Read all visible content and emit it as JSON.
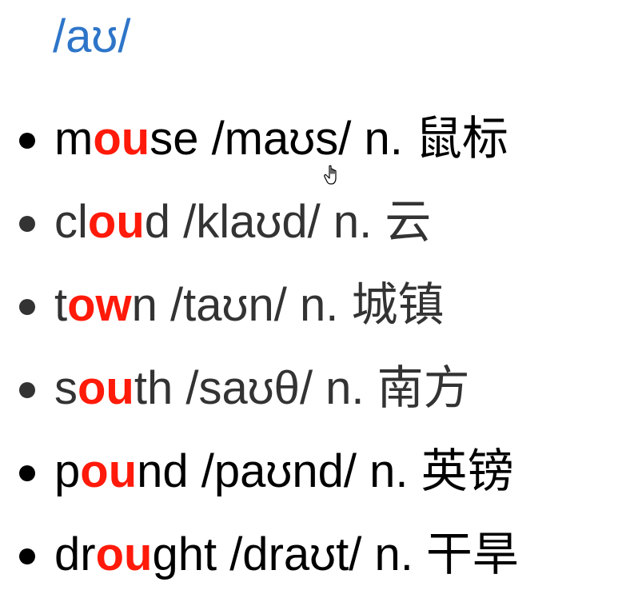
{
  "heading": "/aʊ/",
  "words": [
    {
      "pre": "m",
      "hl": "ou",
      "post": "se",
      "rest": " /maʊs/ n. 鼠标"
    },
    {
      "pre": "cl",
      "hl": "ou",
      "post": "d",
      "rest": " /klaʊd/ n. 云"
    },
    {
      "pre": "t",
      "hl": "ow",
      "post": "n",
      "rest": " /taʊn/ n. 城镇"
    },
    {
      "pre": "s",
      "hl": "ou",
      "post": "th",
      "rest": " /saʊθ/ n. 南方"
    },
    {
      "pre": "p",
      "hl": "ou",
      "post": "nd",
      "rest": " /paʊnd/ n. 英镑"
    },
    {
      "pre": "dr",
      "hl": "ou",
      "post": "ght",
      "rest": " /draʊt/ n. 干旱"
    }
  ],
  "colors": {
    "heading": "#2e75c9",
    "highlight": "#ff1a0a",
    "text": "#333333"
  },
  "cursor_icon": "hand-pointer-icon"
}
